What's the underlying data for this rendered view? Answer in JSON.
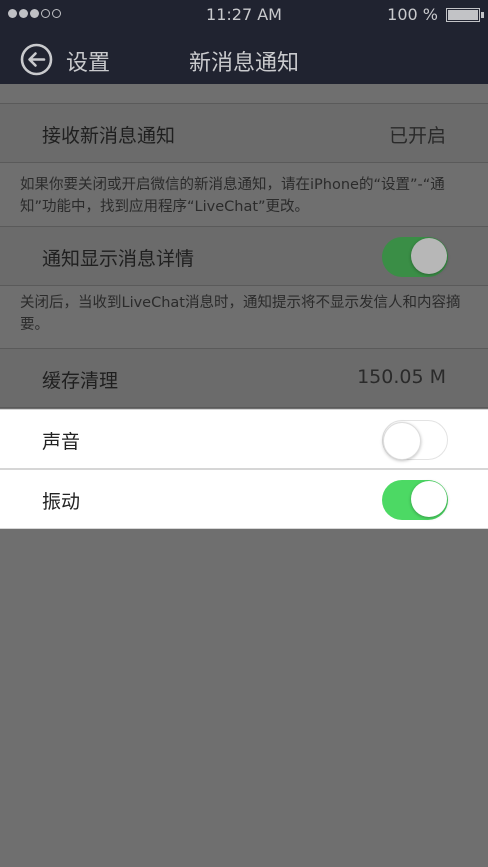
{
  "status_bar": {
    "time": "11:27 AM",
    "battery_percent": "100 %",
    "signal_dots_filled": 3,
    "signal_dots_total": 5
  },
  "nav": {
    "back_label": "设置",
    "title": "新消息通知",
    "back_icon": "back-arrow-circle-icon"
  },
  "settings": {
    "receive_label": "接收新消息通知",
    "receive_value": "已开启",
    "receive_note": "如果你要关闭或开启微信的新消息通知，请在iPhone的“设置”-“通知”功能中，找到应用程序“LiveChat”更改。",
    "details_label": "通知显示消息详情",
    "details_on": true,
    "details_note": "关闭后，当收到LiveChat消息时，通知提示将不显示发信人和内容摘要。",
    "cache_label": "缓存清理",
    "cache_value": "150.05 M",
    "sound_label": "声音",
    "sound_on": false,
    "vibrate_label": "振动",
    "vibrate_on": true
  },
  "colors": {
    "nav_bg": "#202330",
    "toggle_on": "#4cd964",
    "overlay_bg": "#6f6f6f"
  }
}
